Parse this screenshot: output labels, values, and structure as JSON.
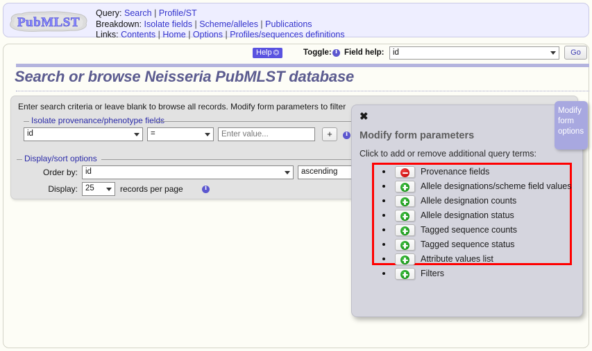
{
  "header": {
    "logo_text": "PubMLST",
    "nav": [
      {
        "label": "Query:",
        "links": [
          "Search",
          "Profile/ST"
        ]
      },
      {
        "label": "Breakdown:",
        "links": [
          "Isolate fields",
          "Scheme/alleles",
          "Publications"
        ]
      },
      {
        "label": "Links:",
        "links": [
          "Contents",
          "Home",
          "Options",
          "Profiles/sequences definitions"
        ]
      }
    ]
  },
  "toolbar": {
    "help_label": "Help",
    "help_external_icon": "external-link-icon",
    "toggle_label": "Toggle:",
    "toggle_info_icon": "info-icon",
    "field_help_label": "Field help:",
    "field_help_value": "id",
    "go_label": "Go"
  },
  "page": {
    "title": "Search or browse Neisseria PubMLST database"
  },
  "form": {
    "intro": "Enter search criteria or leave blank to browse all records. Modify form parameters to filter",
    "provenance": {
      "legend": "Isolate provenance/phenotype fields",
      "field_value": "id",
      "operator_value": "=",
      "value_placeholder": "Enter value...",
      "add_label": "+",
      "info_icon": "info-icon"
    },
    "display": {
      "legend": "Display/sort options",
      "order_by_label": "Order by:",
      "order_by_value": "id",
      "direction_value": "ascending",
      "display_label": "Display:",
      "records_value": "25",
      "records_suffix": "records per page",
      "info_icon": "info-icon"
    }
  },
  "modal": {
    "close_icon": "close-icon",
    "heading": "Modify form parameters",
    "subtitle": "Click to add or remove additional query terms:",
    "tab_label": "Modify form options",
    "highlight_color": "#ff0000",
    "terms": [
      {
        "label": "Provenance fields",
        "action": "remove",
        "icon": "minus-circle-icon"
      },
      {
        "label": "Allele designations/scheme field values",
        "action": "add",
        "icon": "plus-circle-icon"
      },
      {
        "label": "Allele designation counts",
        "action": "add",
        "icon": "plus-circle-icon"
      },
      {
        "label": "Allele designation status",
        "action": "add",
        "icon": "plus-circle-icon"
      },
      {
        "label": "Tagged sequence counts",
        "action": "add",
        "icon": "plus-circle-icon"
      },
      {
        "label": "Tagged sequence status",
        "action": "add",
        "icon": "plus-circle-icon"
      },
      {
        "label": "Attribute values list",
        "action": "add",
        "icon": "plus-circle-icon"
      },
      {
        "label": "Filters",
        "action": "add",
        "icon": "plus-circle-icon"
      }
    ]
  },
  "colors": {
    "accent": "#5a53e0",
    "title": "#5b5b8f",
    "link": "#3333cc",
    "highlight": "#ff0000",
    "add_green": "#0a8a0a",
    "remove_red": "#c10000"
  }
}
